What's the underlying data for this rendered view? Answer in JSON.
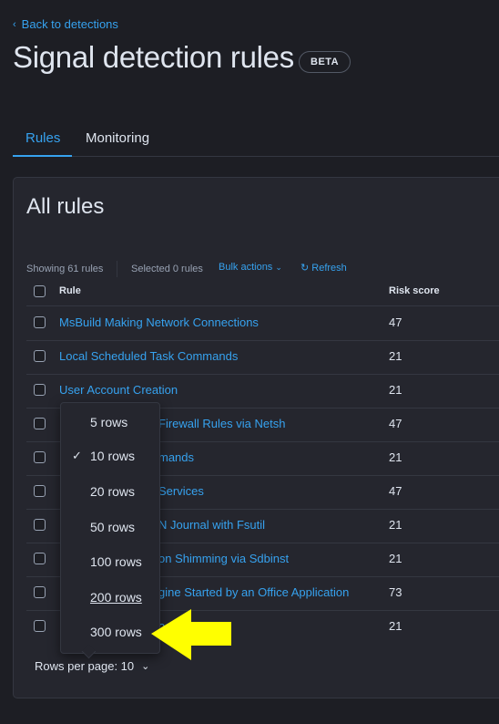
{
  "header": {
    "back_link": "Back to detections",
    "title": "Signal detection rules",
    "badge": "BETA"
  },
  "tabs": [
    {
      "label": "Rules",
      "active": true
    },
    {
      "label": "Monitoring",
      "active": false
    }
  ],
  "panel": {
    "title": "All rules",
    "showing": "Showing 61 rules",
    "selected": "Selected 0 rules",
    "bulk_actions": "Bulk actions",
    "refresh": "Refresh"
  },
  "table": {
    "columns": [
      "Rule",
      "Risk score"
    ],
    "rows": [
      {
        "rule": "MsBuild Making Network Connections",
        "score": "47"
      },
      {
        "rule": "Local Scheduled Task Commands",
        "score": "21"
      },
      {
        "rule": "User Account Creation",
        "score": "21"
      },
      {
        "rule": "Firewall Rules via Netsh",
        "score": "47"
      },
      {
        "rule": "mands",
        "score": "21"
      },
      {
        "rule": "Services",
        "score": "47"
      },
      {
        "rule": "N Journal with Fsutil",
        "score": "21"
      },
      {
        "rule": "on Shimming via Sdbinst",
        "score": "21"
      },
      {
        "rule": "gine Started by an Office Application",
        "score": "73"
      },
      {
        "rule": "ocess",
        "score": "21"
      }
    ]
  },
  "rows_menu": {
    "options": [
      "5 rows",
      "10 rows",
      "20 rows",
      "50 rows",
      "100 rows",
      "200 rows",
      "300 rows"
    ],
    "selected": "10 rows",
    "hovered": "200 rows"
  },
  "pagination": {
    "rows_per_page": "Rows per page: 10"
  },
  "colors": {
    "accent": "#36a2ef",
    "background": "#1d1e24",
    "panel": "#25262e",
    "annotation_arrow": "#ffff00"
  },
  "icons": [
    "chevron-left-icon",
    "chevron-down-icon",
    "refresh-icon",
    "check-icon",
    "checkbox-icon"
  ]
}
